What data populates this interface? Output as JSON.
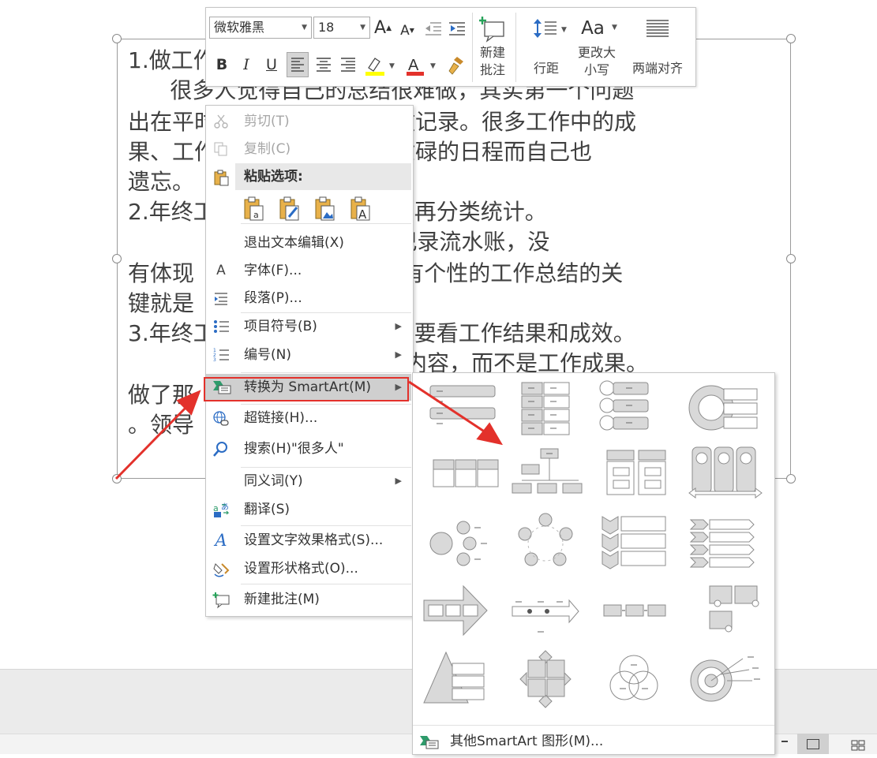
{
  "slide": {
    "lines": [
      "1.做工作",
      "      很多人觉得自己的总结很难做，其实第一个问题",
      "出在平时没有对自己的工作做记录。很多工作中的成",
      "果、工作中的事情，会因为忙碌的日程而自己也",
      "遗忘。",
      "2.年终工作总结要全局框架，再分类统计。",
      "                作总结，那就是记录流水账，没",
      "有体现                 结构化。有个性的工作总结的关",
      "键就是",
      "3.年终工作总结不是工作量，要看工作结果和成效。",
      "                              是工作内容，而不是工作成果。",
      "做了那",
      "。领导"
    ]
  },
  "mini_toolbar": {
    "font_name": "微软雅黑",
    "font_size": "18",
    "grow_font": "A",
    "shrink_font": "A",
    "bold": "B",
    "italic": "I",
    "underline": "U",
    "new_comment_label": "新建\n批注",
    "line_spacing_label": "行距",
    "change_case_icon": "Aa",
    "change_case_label": "更改大\n小写",
    "justify_label": "两端对齐",
    "highlight_color": "#ffff00",
    "font_color": "#e3312b"
  },
  "context_menu": {
    "items": [
      {
        "label": "剪切(T)",
        "icon": "scissors-icon",
        "enabled": false
      },
      {
        "label": "复制(C)",
        "icon": "copy-icon",
        "enabled": false
      },
      {
        "label": "粘贴选项:",
        "icon": "paste-icon",
        "enabled": true
      },
      {
        "label": "退出文本编辑(X)",
        "icon": "",
        "enabled": true
      },
      {
        "label": "字体(F)...",
        "icon": "font-icon",
        "enabled": true
      },
      {
        "label": "段落(P)...",
        "icon": "paragraph-icon",
        "enabled": true
      },
      {
        "label": "项目符号(B)",
        "icon": "bullets-icon",
        "enabled": true,
        "submenu": true
      },
      {
        "label": "编号(N)",
        "icon": "numbering-icon",
        "enabled": true,
        "submenu": true
      },
      {
        "label": "转换为 SmartArt(M)",
        "icon": "smartart-icon",
        "enabled": true,
        "submenu": true,
        "highlighted": true
      },
      {
        "label": "超链接(H)...",
        "icon": "hyperlink-icon",
        "enabled": true
      },
      {
        "label": "搜索(H)\"很多人\"",
        "icon": "search-icon",
        "enabled": true
      },
      {
        "label": "同义词(Y)",
        "icon": "",
        "enabled": true,
        "submenu": true
      },
      {
        "label": "翻译(S)",
        "icon": "translate-icon",
        "enabled": true
      },
      {
        "label": "设置文字效果格式(S)...",
        "icon": "text-effects-icon",
        "enabled": true
      },
      {
        "label": "设置形状格式(O)...",
        "icon": "shape-format-icon",
        "enabled": true
      },
      {
        "label": "新建批注(M)",
        "icon": "comment-icon",
        "enabled": true
      }
    ],
    "paste_options": [
      "keep-source-formatting-icon",
      "use-destination-theme-icon",
      "picture-icon",
      "keep-text-only-icon"
    ]
  },
  "smartart_gallery": {
    "layouts": [
      "vertical-bullet-list",
      "stacked-list",
      "vertical-box-list",
      "nested-target-list",
      "horizontal-bullet-list",
      "org-chart",
      "grouped-list",
      "pillars-list",
      "radial-cluster",
      "basic-cycle",
      "vertical-chevron-list",
      "chevron-list",
      "process-arrows",
      "timeline-arrow",
      "basic-process",
      "picture-process",
      "pyramid-list",
      "matrix",
      "venn",
      "target"
    ],
    "more_label": "其他SmartArt 图形(M)..."
  },
  "colors": {
    "annotation_red": "#e3312b",
    "highlight_gray": "#cfcfcf",
    "shape_gray": "#d9d9d9",
    "shape_stroke": "#8c8c8c"
  }
}
